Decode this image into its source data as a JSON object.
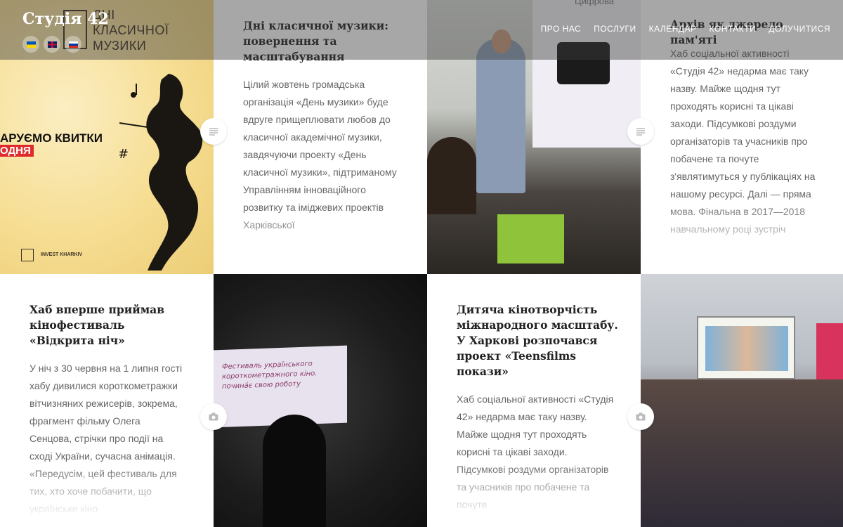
{
  "site": {
    "title": "Студія 42",
    "languages": [
      {
        "code": "uk",
        "colors": [
          "#0057b7",
          "#ffd700"
        ]
      },
      {
        "code": "en",
        "colors": [
          "#012169",
          "#c8102e"
        ]
      },
      {
        "code": "ru",
        "colors": [
          "#ffffff",
          "#0039a6",
          "#d52b1e"
        ]
      }
    ]
  },
  "nav": {
    "items": [
      "ПРО НАС",
      "ПОСЛУГИ",
      "КАЛЕНДАР",
      "КОНТАКТИ",
      "ДОЛУЧИТИСЯ"
    ]
  },
  "poster": {
    "brand_lines": [
      "ДНІ",
      "КЛАСИЧНОЇ",
      "МУЗИКИ"
    ],
    "tickets_text": "АРУЄМО КВИТКИ",
    "today_text": "ОДНЯ",
    "footer_logo": "INVEST KHARKIV"
  },
  "photo_class_screen": {
    "screen_text": "Цифрова"
  },
  "photo_film_screen": {
    "screen_text": "Фестиваль українського короткометражного кіно. почина́є свою роботу"
  },
  "posts": [
    {
      "title": "Дні класичної музики: повернення та масштабування",
      "excerpt": "Цілий жовтень громадська організація «День музики» буде вдруге прищеплювати любов до класичної академічної музики, завдячуючи проекту «День класичної музики», підтриманому Управлінням інноваційного розвитку та іміджевих проектів Харківської",
      "format_icon": "text-format-icon"
    },
    {
      "title": "Архів як джерело пам'яті",
      "excerpt": "Хаб соціальної активності «Студія 42» недарма має таку назву. Майже щодня тут проходять корисні та цікаві заходи. Підсумкові роздуми організаторів та учасників про побачене та почуте з'являтимуться у публікаціях на нашому ресурсі. Далі — пряма мова. Фінальна в 2017—2018 навчальному році зустріч",
      "format_icon": "text-format-icon"
    },
    {
      "title": "Хаб вперше приймав кінофестиваль «Відкрита ніч»",
      "excerpt": "У ніч з 30 червня на 1 липня гості хабу дивилися короткометражки вітчизняних режисерів, зокрема, фрагмент фільму Олега Сенцова, стрічки про події на сході України, сучасна анімація. «Передусім, цей фестиваль для тих, хто хоче побачити, що українське кіно",
      "format_icon": "camera-format-icon"
    },
    {
      "title": "Дитяча кінотворчість міжнародного масштабу. У Харкові розпочався проект «Teensfilms покази»",
      "excerpt": "Хаб соціальної активності «Студія 42» недарма має таку назву. Майже щодня тут проходять корисні та цікаві заходи. Підсумкові роздуми організаторів та учасників про побачене та почуте",
      "format_icon": "camera-format-icon"
    }
  ]
}
